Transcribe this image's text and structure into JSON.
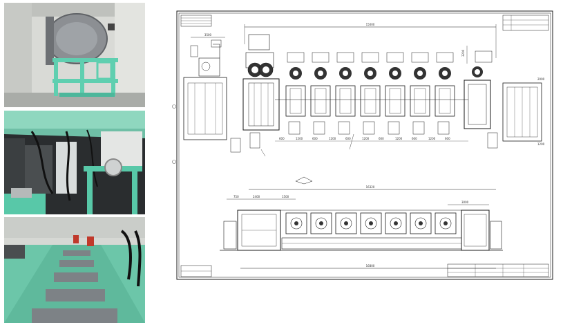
{
  "photos": [
    {
      "icon": "vacuum-chamber-machine-photo",
      "colors": {
        "wall": "#d9dad6",
        "frame": "#5fcfb0",
        "drum": "#8c8f93"
      }
    },
    {
      "icon": "machine-interior-cables-photo",
      "colors": {
        "ceiling": "#8fd7bf",
        "dark": "#2a2d2f",
        "frame": "#58c8a8"
      }
    },
    {
      "icon": "conveyor-bath-line-photo",
      "colors": {
        "floor": "#6cc6a9",
        "tray": "#7d8286",
        "wall": "#d6d8d4"
      }
    }
  ],
  "drawing": {
    "icon": "engineering-drawing-sheet",
    "top_dimension": "15000",
    "right_dimension_top": "3200",
    "top_left_dimension": "3500",
    "bottom_overall_dimension": "16320",
    "bottom_base_dimension": "16800",
    "bottom_left_dims": [
      "750",
      "2400",
      "1500"
    ],
    "bottom_right_dim": "3000",
    "right_dims": [
      "2000",
      "1200"
    ],
    "chain_dims": [
      "600",
      "1200",
      "600",
      "1200",
      "600",
      "1200",
      "600",
      "1200",
      "600",
      "1200",
      "600"
    ],
    "small_left_dim": "1200",
    "colors": {
      "line": "#1a1a1a",
      "paper": "#ffffff"
    }
  }
}
